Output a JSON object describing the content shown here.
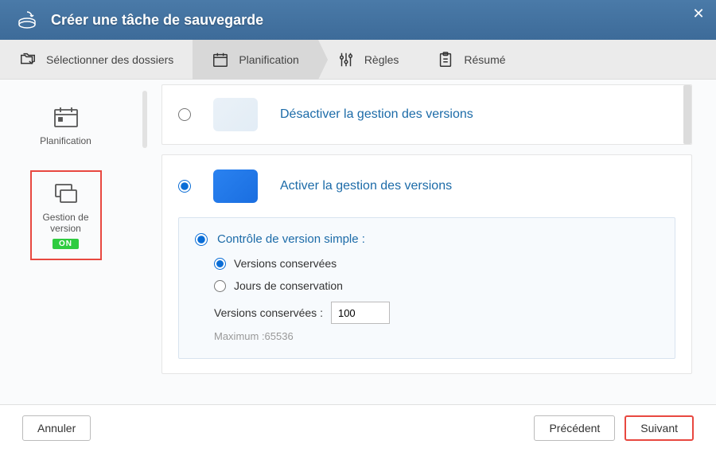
{
  "header": {
    "title": "Créer une tâche de sauvegarde"
  },
  "tabs": {
    "folders": "Sélectionner des dossiers",
    "plan": "Planification",
    "rules": "Règles",
    "summary": "Résumé"
  },
  "sidebar": {
    "plan_label": "Planification",
    "version_label": "Gestion de version",
    "badge": "ON"
  },
  "options": {
    "disable": "Désactiver la gestion des versions",
    "enable": "Activer la gestion des versions"
  },
  "simple": {
    "title": "Contrôle de version simple :",
    "kept": "Versions conservées",
    "days": "Jours de conservation",
    "field_label": "Versions conservées :",
    "field_value": "100",
    "hint": "Maximum :65536"
  },
  "footer": {
    "cancel": "Annuler",
    "prev": "Précédent",
    "next": "Suivant"
  }
}
